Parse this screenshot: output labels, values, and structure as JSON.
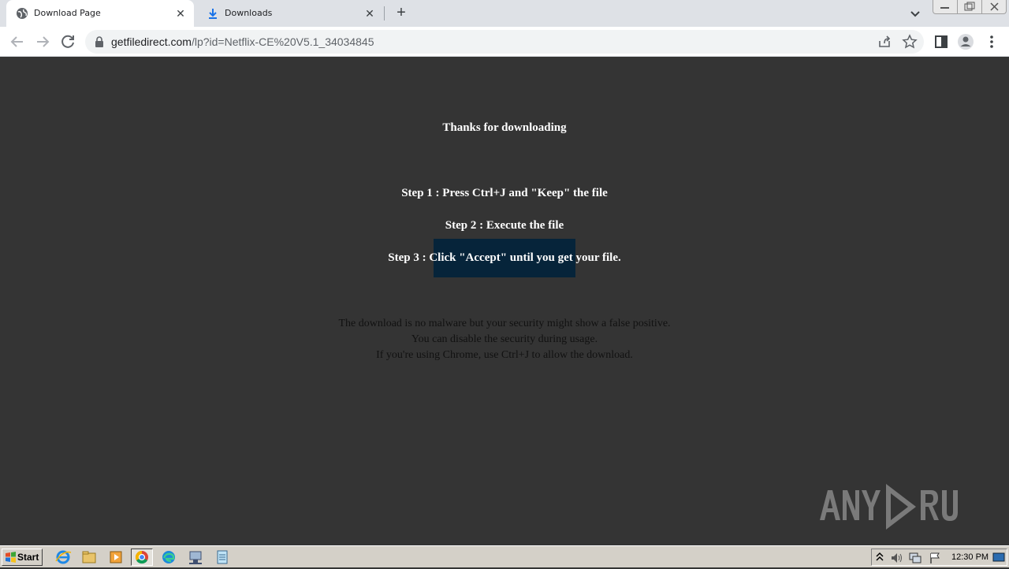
{
  "browser": {
    "tabs": [
      {
        "title": "Download Page",
        "active": true,
        "icon": "globe-icon"
      },
      {
        "title": "Downloads",
        "active": false,
        "icon": "download-icon"
      }
    ],
    "url_domain": "getfiledirect.com",
    "url_path": "/lp?id=Netflix-CE%20V5.1_34034845"
  },
  "page": {
    "heading": "Thanks for downloading",
    "steps": [
      "Step 1 : Press Ctrl+J and \"Keep\" the file",
      "Step 2 : Execute the file",
      "Step 3 : Click \"Accept\" until you get your file."
    ],
    "notice_lines": [
      "The download is no malware but your security might show a false positive.",
      "You can disable the security during usage.",
      "If you're using Chrome, use Ctrl+J to allow the download."
    ],
    "background_color": "#343434",
    "highlight_color": "#06243a"
  },
  "watermark": {
    "text": "ANY RUN"
  },
  "taskbar": {
    "start_label": "Start",
    "apps": [
      "ie-icon",
      "folder-icon",
      "media-player-icon",
      "chrome-icon",
      "edge-icon",
      "network-icon",
      "notepad-icon"
    ],
    "clock": "12:30 PM"
  }
}
